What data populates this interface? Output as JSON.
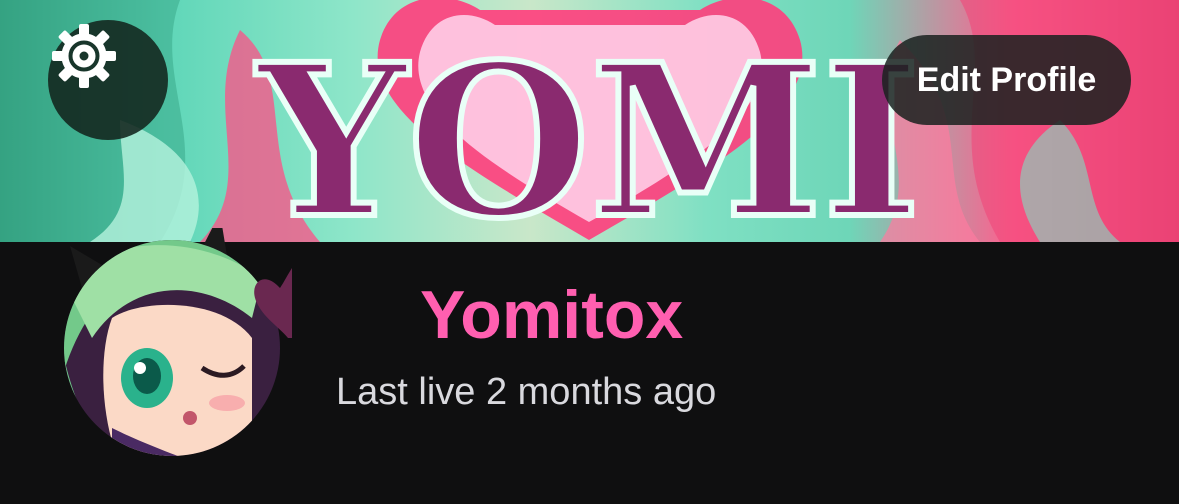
{
  "banner": {
    "logo_text": "YOMI"
  },
  "header": {
    "settings_icon": "gear-icon",
    "edit_profile_label": "Edit Profile"
  },
  "profile": {
    "display_name": "Yomitox",
    "status": "Last live 2 months ago"
  },
  "colors": {
    "name_accent": "#ff5fb0",
    "background": "#0f0f10"
  }
}
